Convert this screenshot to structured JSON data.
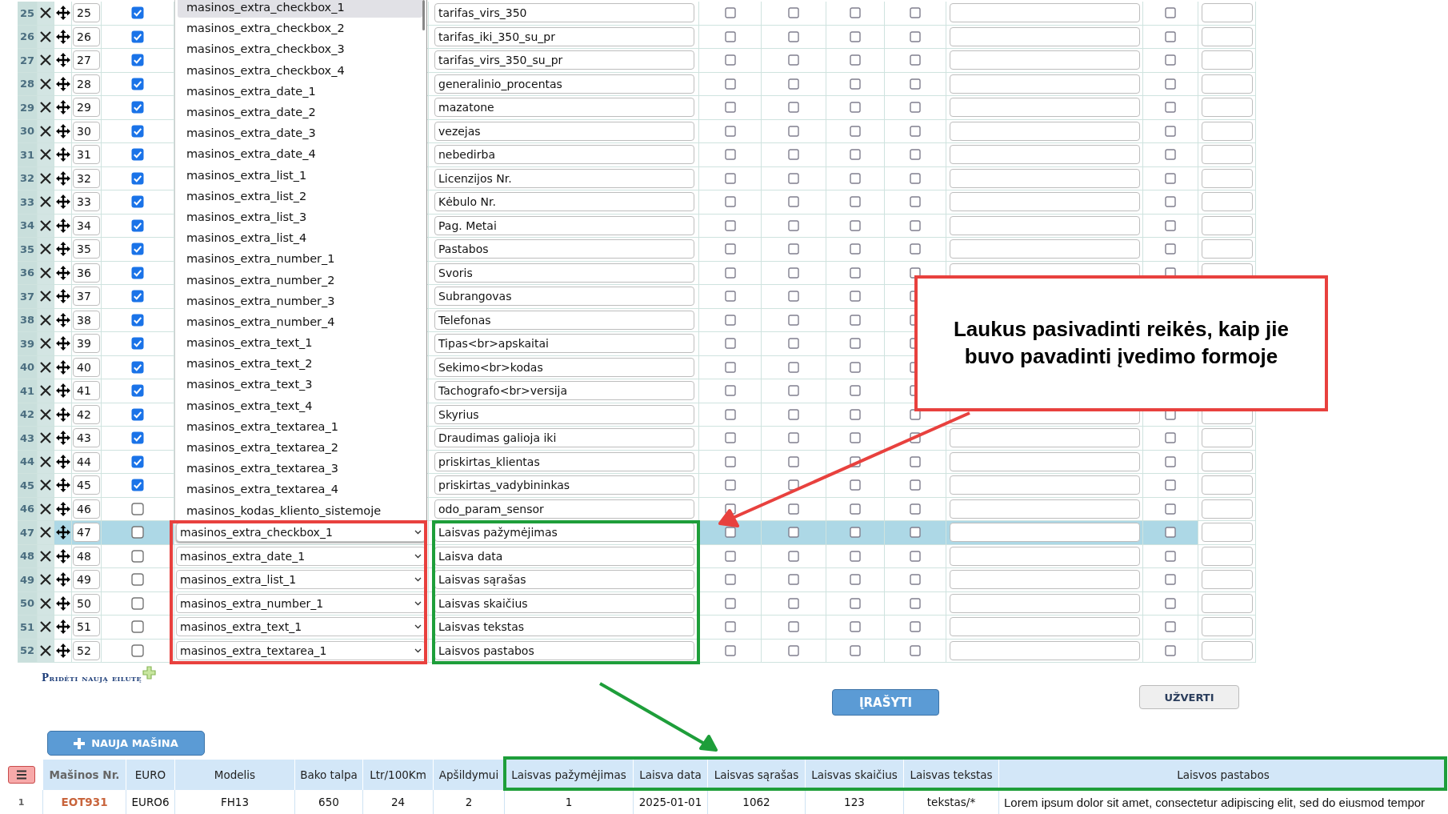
{
  "rows": [
    {
      "number": "25",
      "order": "25",
      "checked": true,
      "label": "tarifas_virs_350",
      "flags": [
        false,
        false,
        false,
        false,
        false
      ],
      "selected": false
    },
    {
      "number": "26",
      "order": "26",
      "checked": true,
      "label": "tarifas_iki_350_su_pr",
      "flags": [
        false,
        false,
        false,
        false,
        false
      ],
      "selected": false
    },
    {
      "number": "27",
      "order": "27",
      "checked": true,
      "label": "tarifas_virs_350_su_pr",
      "flags": [
        false,
        false,
        false,
        false,
        false
      ],
      "selected": false
    },
    {
      "number": "28",
      "order": "28",
      "checked": true,
      "label": "generalinio_procentas",
      "flags": [
        false,
        false,
        false,
        false,
        false
      ],
      "selected": false
    },
    {
      "number": "29",
      "order": "29",
      "checked": true,
      "label": "mazatone",
      "flags": [
        false,
        false,
        false,
        false,
        false
      ],
      "selected": false
    },
    {
      "number": "30",
      "order": "30",
      "checked": true,
      "label": "vezejas",
      "flags": [
        false,
        false,
        false,
        false,
        false
      ],
      "selected": false
    },
    {
      "number": "31",
      "order": "31",
      "checked": true,
      "label": "nebedirba",
      "flags": [
        false,
        false,
        false,
        false,
        false
      ],
      "selected": false
    },
    {
      "number": "32",
      "order": "32",
      "checked": true,
      "label": "Licenzijos Nr.",
      "flags": [
        false,
        false,
        false,
        false,
        false
      ],
      "selected": false
    },
    {
      "number": "33",
      "order": "33",
      "checked": true,
      "label": "Kėbulo Nr.",
      "flags": [
        false,
        false,
        false,
        false,
        false
      ],
      "selected": false
    },
    {
      "number": "34",
      "order": "34",
      "checked": true,
      "label": "Pag. Metai",
      "flags": [
        false,
        false,
        false,
        false,
        false
      ],
      "selected": false
    },
    {
      "number": "35",
      "order": "35",
      "checked": true,
      "label": "Pastabos",
      "flags": [
        false,
        false,
        false,
        false,
        false
      ],
      "selected": false
    },
    {
      "number": "36",
      "order": "36",
      "checked": true,
      "label": "Svoris",
      "flags": [
        false,
        false,
        false,
        false,
        false
      ],
      "selected": false
    },
    {
      "number": "37",
      "order": "37",
      "checked": true,
      "label": "Subrangovas",
      "flags": [
        false,
        false,
        false,
        false
      ],
      "selected": false
    },
    {
      "number": "38",
      "order": "38",
      "checked": true,
      "label": "Telefonas",
      "flags": [
        false,
        false,
        false,
        false
      ],
      "selected": false
    },
    {
      "number": "39",
      "order": "39",
      "checked": true,
      "label": "Tipas<br>apskaitai",
      "flags": [
        false,
        false,
        false,
        false
      ],
      "selected": false
    },
    {
      "number": "40",
      "order": "40",
      "checked": true,
      "label": "Sekimo<br>kodas",
      "flags": [
        false,
        false,
        false,
        false
      ],
      "selected": false
    },
    {
      "number": "41",
      "order": "41",
      "checked": true,
      "label": "Tachografo<br>versija",
      "flags": [
        false,
        false,
        false,
        false
      ],
      "selected": false
    },
    {
      "number": "42",
      "order": "42",
      "checked": true,
      "label": "Skyrius",
      "flags": [
        false,
        false,
        false,
        false,
        false
      ],
      "selected": false
    },
    {
      "number": "43",
      "order": "43",
      "checked": true,
      "label": "Draudimas galioja iki",
      "flags": [
        false,
        false,
        false,
        false,
        false
      ],
      "selected": false
    },
    {
      "number": "44",
      "order": "44",
      "checked": true,
      "label": "priskirtas_klientas",
      "flags": [
        false,
        false,
        false,
        false,
        false
      ],
      "selected": false
    },
    {
      "number": "45",
      "order": "45",
      "checked": true,
      "label": "priskirtas_vadybininkas",
      "flags": [
        false,
        false,
        false,
        false,
        false
      ],
      "selected": false
    },
    {
      "number": "46",
      "order": "46",
      "checked": false,
      "label": "odo_param_sensor",
      "flags": [
        false,
        false,
        false,
        false,
        false
      ],
      "selected": false
    },
    {
      "number": "47",
      "order": "47",
      "checked": false,
      "field": "masinos_extra_checkbox_1",
      "label": "Laisvas pažymėjimas",
      "flags": [
        false,
        false,
        false,
        false,
        false
      ],
      "selected": true
    },
    {
      "number": "48",
      "order": "48",
      "checked": false,
      "field": "masinos_extra_date_1",
      "label": "Laisva data",
      "flags": [
        false,
        false,
        false,
        false,
        false
      ],
      "selected": false
    },
    {
      "number": "49",
      "order": "49",
      "checked": false,
      "field": "masinos_extra_list_1",
      "label": "Laisvas sąrašas",
      "flags": [
        false,
        false,
        false,
        false,
        false
      ],
      "selected": false
    },
    {
      "number": "50",
      "order": "50",
      "checked": false,
      "field": "masinos_extra_number_1",
      "label": "Laisvas skaičius",
      "flags": [
        false,
        false,
        false,
        false,
        false
      ],
      "selected": false
    },
    {
      "number": "51",
      "order": "51",
      "checked": false,
      "field": "masinos_extra_text_1",
      "label": "Laisvas tekstas",
      "flags": [
        false,
        false,
        false,
        false,
        false
      ],
      "selected": false
    },
    {
      "number": "52",
      "order": "52",
      "checked": false,
      "field": "masinos_extra_textarea_1",
      "label": "Laisvos pastabos",
      "flags": [
        false,
        false,
        false,
        false,
        false
      ],
      "selected": false
    }
  ],
  "field_menu": {
    "items": [
      {
        "text": "masinos_extra_checkbox_1",
        "selected": true
      },
      {
        "text": "masinos_extra_checkbox_2",
        "selected": false
      },
      {
        "text": "masinos_extra_checkbox_3",
        "selected": false
      },
      {
        "text": "masinos_extra_checkbox_4",
        "selected": false
      },
      {
        "text": "masinos_extra_date_1",
        "selected": false
      },
      {
        "text": "masinos_extra_date_2",
        "selected": false
      },
      {
        "text": "masinos_extra_date_3",
        "selected": false
      },
      {
        "text": "masinos_extra_date_4",
        "selected": false
      },
      {
        "text": "masinos_extra_list_1",
        "selected": false
      },
      {
        "text": "masinos_extra_list_2",
        "selected": false
      },
      {
        "text": "masinos_extra_list_3",
        "selected": false
      },
      {
        "text": "masinos_extra_list_4",
        "selected": false
      },
      {
        "text": "masinos_extra_number_1",
        "selected": false
      },
      {
        "text": "masinos_extra_number_2",
        "selected": false
      },
      {
        "text": "masinos_extra_number_3",
        "selected": false
      },
      {
        "text": "masinos_extra_number_4",
        "selected": false
      },
      {
        "text": "masinos_extra_text_1",
        "selected": false
      },
      {
        "text": "masinos_extra_text_2",
        "selected": false
      },
      {
        "text": "masinos_extra_text_3",
        "selected": false
      },
      {
        "text": "masinos_extra_text_4",
        "selected": false
      },
      {
        "text": "masinos_extra_textarea_1",
        "selected": false
      },
      {
        "text": "masinos_extra_textarea_2",
        "selected": false
      },
      {
        "text": "masinos_extra_textarea_3",
        "selected": false
      },
      {
        "text": "masinos_extra_textarea_4",
        "selected": false
      },
      {
        "text": "masinos_kodas_kliento_sistemoje",
        "selected": false
      }
    ]
  },
  "callout": {
    "text": "Laukus pasivadinti reikės, kaip jie buvo pavadinti įvedimo formoje"
  },
  "add_row_link": "Pridėti naują eilutę",
  "buttons": {
    "save": "ĮRAŠYTI",
    "close": "UŽVERTI"
  },
  "new_car_button": "NAUJA MAŠINA",
  "cars_table": {
    "columns": [
      "",
      "Mašinos Nr.",
      "EURO",
      "Modelis",
      "Bako talpa",
      "Ltr/100Km",
      "Apšildymui",
      "Laisvas pažymėjimas",
      "Laisva data",
      "Laisvas sąrašas",
      "Laisvas skaičius",
      "Laisvas tekstas",
      "Laisvos pastabos"
    ],
    "rows": [
      {
        "cells": [
          "1",
          "EOT931",
          "EURO6",
          "FH13",
          "650",
          "24",
          "2",
          "1",
          "2025-01-01",
          "1062",
          "123",
          "tekstas/*",
          "Lorem ipsum dolor sit amet, consectetur adipiscing elit, sed do eiusmod tempor"
        ]
      }
    ]
  }
}
